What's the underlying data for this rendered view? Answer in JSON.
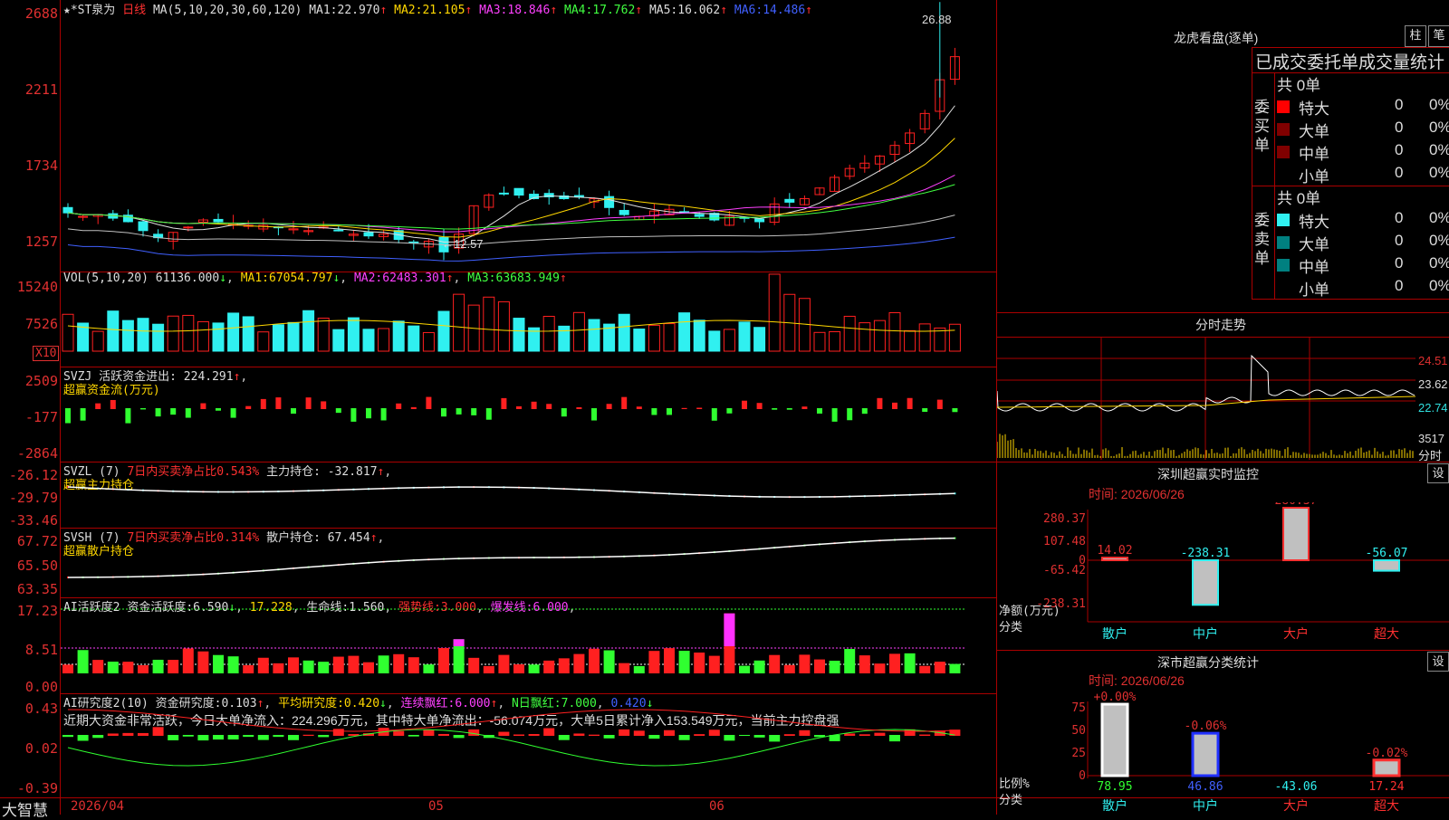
{
  "main": {
    "title_prefix": "★*ST泉为",
    "period": "日线",
    "ma_params": "MA(5,10,20,30,60,120)",
    "ma": [
      {
        "label": "MA1:",
        "value": "22.970",
        "arrow": "↑"
      },
      {
        "label": "MA2:",
        "value": "21.105",
        "arrow": "↑"
      },
      {
        "label": "MA3:",
        "value": "18.846",
        "arrow": "↑"
      },
      {
        "label": "MA4:",
        "value": "17.762",
        "arrow": "↑"
      },
      {
        "label": "MA5:",
        "value": "16.062",
        "arrow": "↑"
      },
      {
        "label": "MA6:",
        "value": "14.486",
        "arrow": "↑"
      }
    ],
    "ylabels": [
      "2688",
      "2211",
      "1734",
      "1257"
    ],
    "high_label": "26.88",
    "low_label": "←12.57",
    "colors": {
      "up": "#ff2020",
      "down": "#30f0f0",
      "ma1": "#e0e0e0",
      "ma2": "#ffd700",
      "ma3": "#ff40ff",
      "ma4": "#40ff40",
      "ma5": "#c0c0c0",
      "ma6": "#4060ff"
    }
  },
  "vol": {
    "header": "VOL(5,10,20)",
    "value": "61136.000",
    "arrow": "↓",
    "ma": [
      {
        "label": "MA1:",
        "value": "67054.797",
        "arrow": "↓"
      },
      {
        "label": "MA2:",
        "value": "62483.301",
        "arrow": "↑"
      },
      {
        "label": "MA3:",
        "value": "63683.949",
        "arrow": "↑"
      }
    ],
    "ylabels": [
      "15240",
      "7526"
    ],
    "unit": "X10"
  },
  "svzj": {
    "header": "SVZJ",
    "label": "活跃资金进出:",
    "value": "224.291",
    "arrow": "↑",
    "sub": "超赢资金流(万元)",
    "ylabels": [
      "2509",
      "-177",
      "-2864"
    ]
  },
  "svzl": {
    "header": "SVZL (7)",
    "label1": "7日内买卖净占比0.543%",
    "label2": "主力持仓:",
    "value": "-32.817",
    "arrow": "↑",
    "sub": "超赢主力持仓",
    "ylabels": [
      "-26.12",
      "-29.79",
      "-33.46"
    ]
  },
  "svsh": {
    "header": "SVSH (7)",
    "label1": "7日内买卖净占比0.314%",
    "label2": "散户持仓:",
    "value": "67.454",
    "arrow": "↑",
    "sub": "超赢散户持仓",
    "ylabels": [
      "67.72",
      "65.50",
      "63.35"
    ]
  },
  "ai1": {
    "header": "AI活跃度2",
    "label": "资金活跃度:",
    "value": "6.590",
    "arrow": "↓",
    "v2": "17.228",
    "label3": "生命线:",
    "v3": "1.560",
    "label4": "强势线:",
    "v4": "3.000",
    "label5": "爆发线:",
    "v5": "6.000",
    "ylabels": [
      "17.23",
      "8.51",
      "0.00"
    ]
  },
  "ai2": {
    "header": "AI研究度2(10)",
    "label": "资金研究度:",
    "value": "0.103",
    "arrow": "↑",
    "label2": "平均研究度:",
    "v2": "0.420",
    "arrow2": "↓",
    "label3": "连续飘红:",
    "v3": "6.000",
    "arrow3": "↑",
    "label4": "N日飘红:",
    "v4": "7.000",
    "v5": "0.420",
    "arrow5": "↓",
    "desc": "近期大资金非常活跃，今日大单净流入：224.296万元，其中特大单净流出：-56.074万元，大单5日累计净入153.549万元，当前主力控盘强",
    "ylabels": [
      "0.43",
      "0.02",
      "-0.39"
    ]
  },
  "xaxis": {
    "labels": [
      "2026/04",
      "05",
      "06"
    ]
  },
  "brand": "大智慧",
  "lhb": {
    "title": "龙虎看盘(逐单)",
    "btn1": "柱",
    "btn2": "笔",
    "header": "已成交委托单成交量统计",
    "buy_label": "委买单",
    "sell_label": "委卖单",
    "buy_total": "共 0单",
    "sell_total": "共 0单",
    "rows": [
      {
        "name": "特大",
        "count": "0",
        "pct": "0%"
      },
      {
        "name": "大单",
        "count": "0",
        "pct": "0%"
      },
      {
        "name": "中单",
        "count": "0",
        "pct": "0%"
      },
      {
        "name": "小单",
        "count": "0",
        "pct": "0%"
      }
    ],
    "buy_colors": [
      "#ff0000",
      "#800000",
      "#800000",
      "#000"
    ],
    "sell_colors": [
      "#30f0f0",
      "#008080",
      "#008080",
      "#000"
    ]
  },
  "fs": {
    "title": "分时走势",
    "ylabels": [
      "24.51",
      "23.62",
      "22.74"
    ],
    "vol_label": "3517",
    "vol_unit": "分时"
  },
  "sz1": {
    "title": "深圳超赢实时监控",
    "set": "设",
    "time": "时间: 2026/06/26",
    "ylabels": [
      "280.37",
      "107.48",
      "0",
      "-65.42",
      "-238.31"
    ],
    "yunit": "净额(万元)",
    "xunit": "分类",
    "chart_data": {
      "type": "bar",
      "categories": [
        "散户",
        "中户",
        "大户",
        "超大"
      ],
      "values": [
        14.02,
        -238.31,
        280.37,
        -56.07
      ],
      "ylim": [
        -238.31,
        280.37
      ]
    }
  },
  "sz2": {
    "title": "深市超赢分类统计",
    "set": "设",
    "time": "时间: 2026/06/26",
    "ylabels": [
      "75",
      "50",
      "25",
      "0"
    ],
    "yunit": "比例%",
    "xunit": "分类",
    "chart_data": {
      "type": "bar",
      "categories": [
        "散户",
        "中户",
        "大户",
        "超大"
      ],
      "values": [
        78.95,
        46.86,
        -43.06,
        17.24
      ],
      "changes": [
        "+0.00%",
        "-0.06%",
        "",
        "-0.02%"
      ]
    }
  }
}
